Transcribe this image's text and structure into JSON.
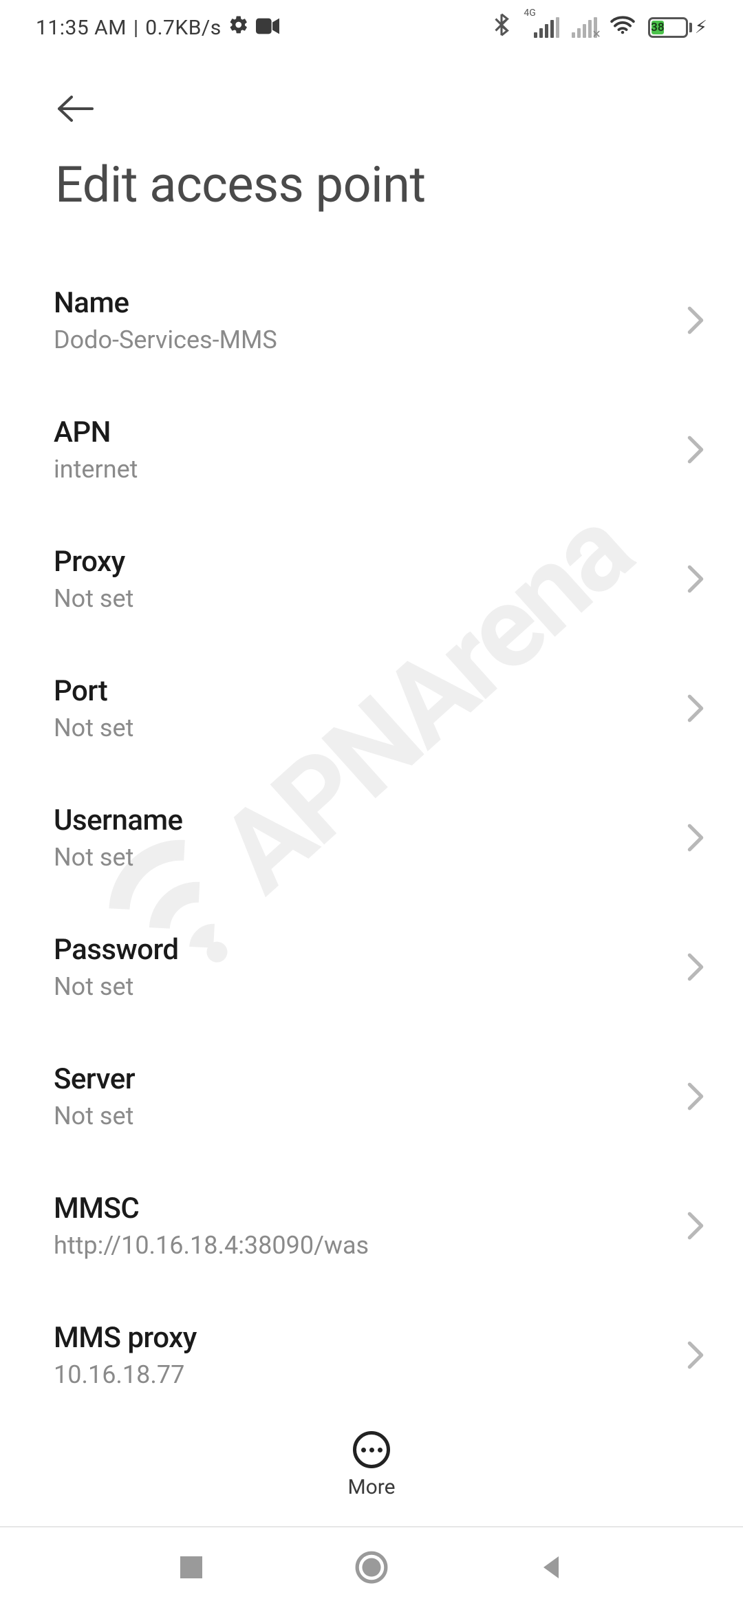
{
  "status": {
    "time": "11:35 AM",
    "separator": "|",
    "data_rate": "0.7KB/s",
    "network_label": "4G",
    "battery_percent": "38"
  },
  "header": {
    "title": "Edit access point"
  },
  "settings": [
    {
      "key": "name",
      "label": "Name",
      "value": "Dodo-Services-MMS"
    },
    {
      "key": "apn",
      "label": "APN",
      "value": "internet"
    },
    {
      "key": "proxy",
      "label": "Proxy",
      "value": "Not set"
    },
    {
      "key": "port",
      "label": "Port",
      "value": "Not set"
    },
    {
      "key": "username",
      "label": "Username",
      "value": "Not set"
    },
    {
      "key": "password",
      "label": "Password",
      "value": "Not set"
    },
    {
      "key": "server",
      "label": "Server",
      "value": "Not set"
    },
    {
      "key": "mmsc",
      "label": "MMSC",
      "value": "http://10.16.18.4:38090/was"
    },
    {
      "key": "mms_proxy",
      "label": "MMS proxy",
      "value": "10.16.18.77"
    }
  ],
  "bottom_action": {
    "more_label": "More"
  },
  "watermark": {
    "text": "APNArena"
  }
}
